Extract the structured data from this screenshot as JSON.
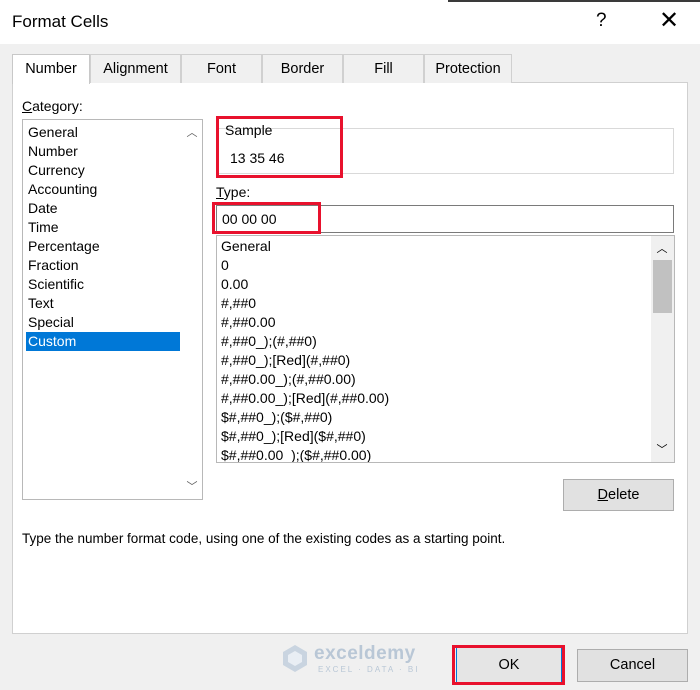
{
  "window": {
    "title": "Format Cells",
    "help_label": "?",
    "close_label": "✕"
  },
  "tabs": [
    {
      "label": "Number",
      "active": true
    },
    {
      "label": "Alignment",
      "active": false
    },
    {
      "label": "Font",
      "active": false
    },
    {
      "label": "Border",
      "active": false
    },
    {
      "label": "Fill",
      "active": false
    },
    {
      "label": "Protection",
      "active": false
    }
  ],
  "category": {
    "label_first": "C",
    "label_rest": "ategory:",
    "items": [
      "General",
      "Number",
      "Currency",
      "Accounting",
      "Date",
      "Time",
      "Percentage",
      "Fraction",
      "Scientific",
      "Text",
      "Special",
      "Custom"
    ],
    "selected": "Custom"
  },
  "sample": {
    "label": "Sample",
    "value": "13 35 46"
  },
  "type": {
    "label_first": "T",
    "label_rest": "ype:",
    "value": "00 00 00",
    "formats": [
      "General",
      "0",
      "0.00",
      "#,##0",
      "#,##0.00",
      "#,##0_);(#,##0)",
      "#,##0_);[Red](#,##0)",
      "#,##0.00_);(#,##0.00)",
      "#,##0.00_);[Red](#,##0.00)",
      "$#,##0_);($#,##0)",
      "$#,##0_);[Red]($#,##0)",
      "$#,##0.00_);($#,##0.00)"
    ]
  },
  "buttons": {
    "delete_first": "D",
    "delete_rest": "elete",
    "ok": "OK",
    "cancel": "Cancel"
  },
  "description": "Type the number format code, using one of the existing codes as a starting point.",
  "watermark": {
    "name": "exceldemy",
    "tagline": "EXCEL · DATA · BI"
  },
  "colors": {
    "highlight": "#e8112d",
    "selection": "#0078d7"
  }
}
